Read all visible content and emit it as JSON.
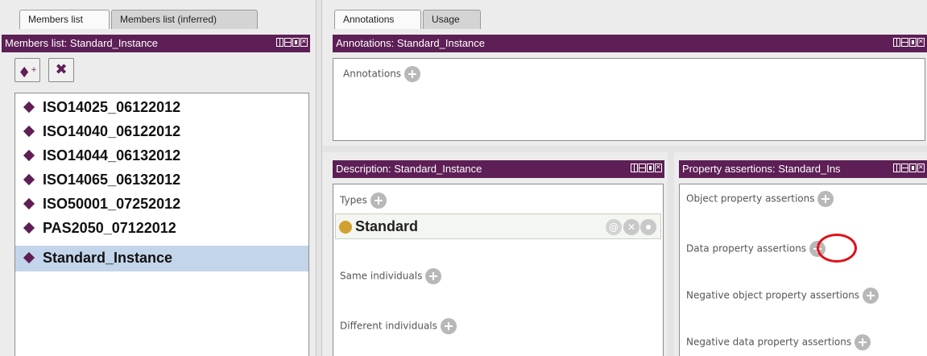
{
  "left_tabs": [
    "Members list",
    "Members list (inferred)"
  ],
  "members_panel": {
    "title": "Members list: Standard_Instance",
    "items": [
      "ISO14025_06122012",
      "ISO14040_06122012",
      "ISO14044_06132012",
      "ISO14065_06132012",
      "ISO50001_07252012",
      "PAS2050_07122012",
      "Standard_Instance"
    ],
    "selected_index": 6
  },
  "right_tabs": [
    "Annotations",
    "Usage"
  ],
  "annotations_panel": {
    "title": "Annotations: Standard_Instance",
    "section_label": "Annotations"
  },
  "description_panel": {
    "title": "Description: Standard_Instance",
    "types_label": "Types",
    "type_item": "Standard",
    "same_label": "Same individuals",
    "different_label": "Different individuals"
  },
  "property_panel": {
    "title": "Property assertions: Standard_Ins",
    "object_label": "Object property assertions",
    "data_label": "Data property assertions",
    "neg_object_label": "Negative object property assertions",
    "neg_data_label": "Negative data property assertions"
  },
  "colors": {
    "header": "#5d1f55",
    "selection": "#c3d5ea",
    "class_dot": "#d2a02f",
    "highlight_circle": "#e0101a"
  }
}
